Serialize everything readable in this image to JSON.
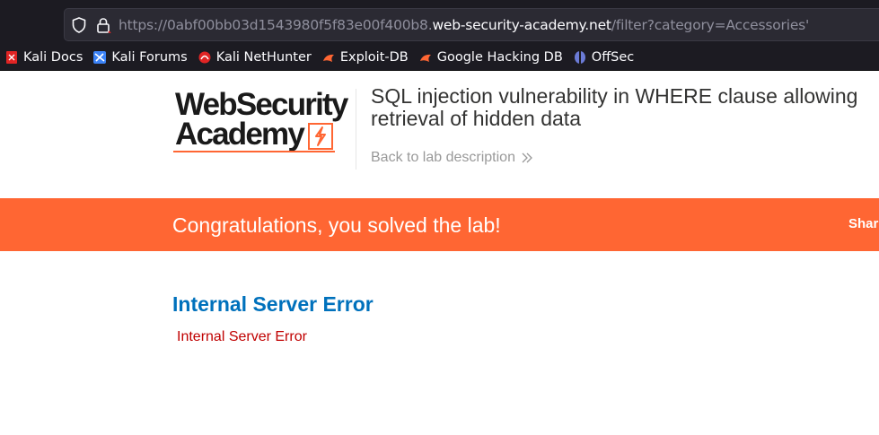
{
  "browser": {
    "url_prefix": "https://0abf00bb03d1543980f5f83e00f400b8.",
    "url_domain": "web-security-academy.net",
    "url_path": "/filter?category=Accessories'",
    "bookmarks": [
      {
        "label": "Kali Docs",
        "icon": "kali-docs-icon",
        "color": "#e02424"
      },
      {
        "label": "Kali Forums",
        "icon": "kali-forums-icon",
        "color": "#3b82f6"
      },
      {
        "label": "Kali NetHunter",
        "icon": "kali-nethunter-icon",
        "color": "#e02424"
      },
      {
        "label": "Exploit-DB",
        "icon": "exploit-db-icon",
        "color": "#ff6633"
      },
      {
        "label": "Google Hacking DB",
        "icon": "google-hacking-db-icon",
        "color": "#ff6633"
      },
      {
        "label": "OffSec",
        "icon": "offsec-icon",
        "color": "#6b7bd6"
      }
    ]
  },
  "header": {
    "logo_line1": "WebSecurity",
    "logo_line2": "Academy",
    "lab_title": "SQL injection vulnerability in WHERE clause allowing retrieval of hidden data",
    "back_link": "Back to lab description"
  },
  "banner": {
    "message": "Congratulations, you solved the lab!",
    "share": "Share"
  },
  "content": {
    "error_heading": "Internal Server Error",
    "error_message": "Internal Server Error"
  },
  "colors": {
    "accent": "#ff6633",
    "heading_blue": "#0071bc",
    "error_red": "#c00000"
  }
}
